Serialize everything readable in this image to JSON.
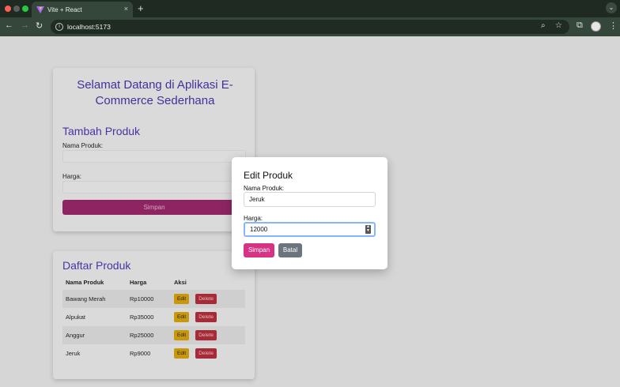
{
  "browser": {
    "tab_title": "Vite + React",
    "tab_close": "×",
    "new_tab": "+",
    "tab_menu": "⌄",
    "url": "localhost:5173",
    "colors": {
      "tabbar": "#1e2a22",
      "toolbar": "#35463b"
    }
  },
  "app": {
    "welcome_title": "Selamat Datang di Aplikasi E-Commerce Sederhana",
    "add_section": {
      "title": "Tambah Produk",
      "name_label": "Nama Produk:",
      "price_label": "Harga:",
      "submit_label": "Simpan"
    },
    "list_section": {
      "title": "Daftar Produk",
      "columns": [
        "Nama Produk",
        "Harga",
        "Aksi"
      ],
      "rows": [
        {
          "name": "Bawang Merah",
          "price": "Rp10000"
        },
        {
          "name": "Alpukat",
          "price": "Rp35000"
        },
        {
          "name": "Anggur",
          "price": "Rp25000"
        },
        {
          "name": "Jeruk",
          "price": "Rp9000"
        }
      ],
      "edit_label": "Edit",
      "delete_label": "Delete"
    }
  },
  "modal": {
    "title": "Edit Produk",
    "name_label": "Nama Produk:",
    "name_value": "Jeruk",
    "price_label": "Harga:",
    "price_value": "12000",
    "save_label": "Simpan",
    "cancel_label": "Batal",
    "colors": {
      "save": "#d63384",
      "cancel": "#6c757d"
    }
  }
}
